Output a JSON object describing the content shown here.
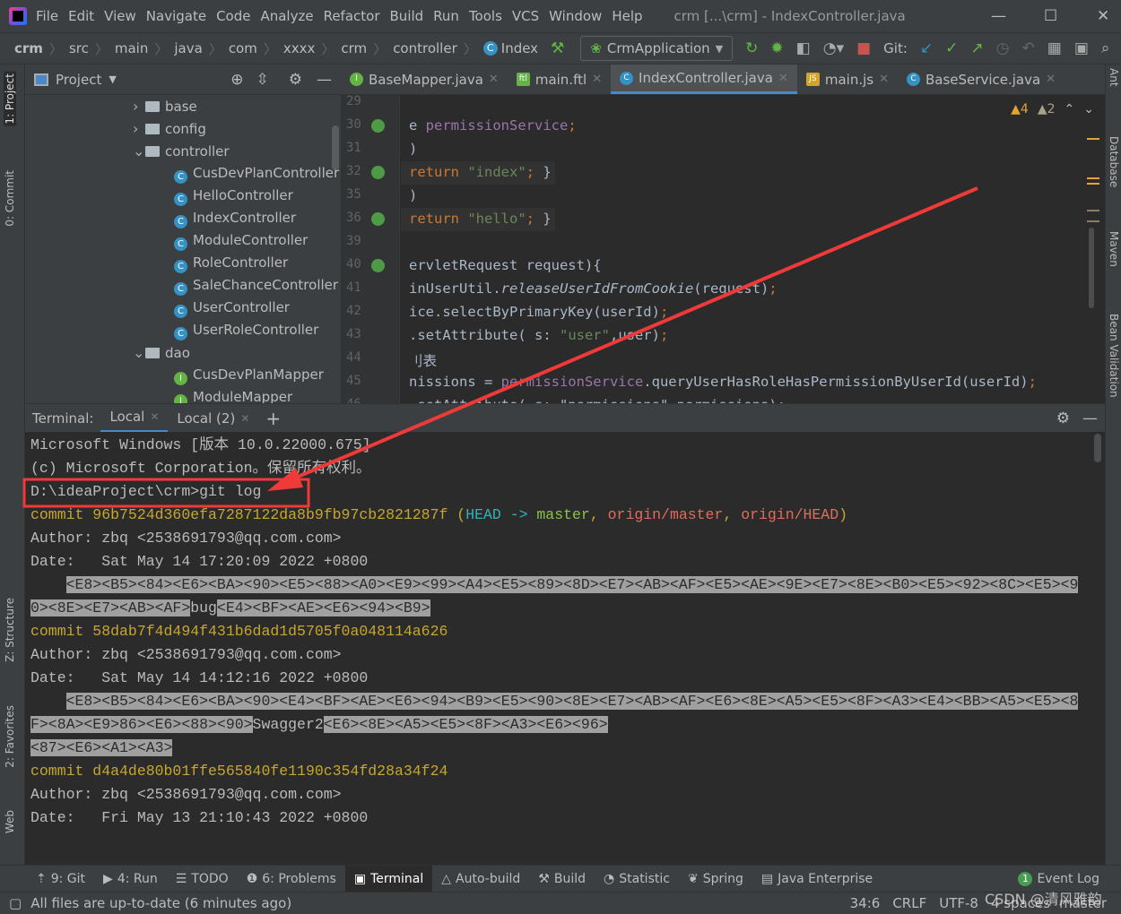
{
  "window": {
    "title": "crm [...\\crm] - IndexController.java",
    "menu": [
      "File",
      "Edit",
      "View",
      "Navigate",
      "Code",
      "Analyze",
      "Refactor",
      "Build",
      "Run",
      "Tools",
      "VCS",
      "Window",
      "Help"
    ],
    "controls": {
      "minimize": "—",
      "maximize": "☐",
      "close": "✕"
    }
  },
  "navbar": {
    "breadcrumbs": [
      "crm",
      "src",
      "main",
      "java",
      "com",
      "xxxx",
      "crm",
      "controller",
      "Index"
    ],
    "run_config": "CrmApplication",
    "git_label": "Git:"
  },
  "left_strip": [
    "1: Project",
    "0: Commit",
    "Z: Structure",
    "2: Favorites",
    "Web"
  ],
  "right_strip": [
    "Ant",
    "Database",
    "Maven",
    "Bean Validation"
  ],
  "project": {
    "title": "Project",
    "tree": [
      {
        "label": "base",
        "type": "folder",
        "depth": 0,
        "chevron": ">"
      },
      {
        "label": "config",
        "type": "folder",
        "depth": 0,
        "chevron": ">"
      },
      {
        "label": "controller",
        "type": "folder",
        "depth": 0,
        "chevron": "v"
      },
      {
        "label": "CusDevPlanController",
        "type": "class",
        "depth": 1
      },
      {
        "label": "HelloController",
        "type": "class",
        "depth": 1
      },
      {
        "label": "IndexController",
        "type": "class",
        "depth": 1
      },
      {
        "label": "ModuleController",
        "type": "class",
        "depth": 1
      },
      {
        "label": "RoleController",
        "type": "class",
        "depth": 1
      },
      {
        "label": "SaleChanceController",
        "type": "class",
        "depth": 1
      },
      {
        "label": "UserController",
        "type": "class",
        "depth": 1
      },
      {
        "label": "UserRoleController",
        "type": "class",
        "depth": 1
      },
      {
        "label": "dao",
        "type": "folder",
        "depth": 0,
        "chevron": "v"
      },
      {
        "label": "CusDevPlanMapper",
        "type": "interface",
        "depth": 1
      },
      {
        "label": "ModuleMapper",
        "type": "interface",
        "depth": 1
      }
    ]
  },
  "editor": {
    "tabs": [
      {
        "label": "BaseMapper.java",
        "icon": "I",
        "active": false
      },
      {
        "label": "main.ftl",
        "icon": "ftl",
        "active": false
      },
      {
        "label": "IndexController.java",
        "icon": "C",
        "active": true
      },
      {
        "label": "main.js",
        "icon": "JS",
        "active": false
      },
      {
        "label": "BaseService.java",
        "icon": "C",
        "active": false
      }
    ],
    "warnings": {
      "errors": "4",
      "weak": "2"
    },
    "lines": [
      {
        "n": "29",
        "parts": []
      },
      {
        "n": "30",
        "parts": [
          {
            "t": "e ",
            "c": ""
          },
          {
            "t": "permissionService",
            "c": "fld"
          },
          {
            "t": ";",
            "c": "kw"
          }
        ]
      },
      {
        "n": "31",
        "parts": [
          {
            "t": ")",
            "c": ""
          }
        ]
      },
      {
        "n": "32",
        "parts": [
          {
            "t": "return ",
            "c": "kw"
          },
          {
            "t": "\"index\"",
            "c": "str"
          },
          {
            "t": "; ",
            "c": "kw"
          },
          {
            "t": "}",
            "c": ""
          }
        ]
      },
      {
        "n": "35",
        "parts": [
          {
            "t": ")",
            "c": ""
          }
        ]
      },
      {
        "n": "36",
        "parts": [
          {
            "t": "return ",
            "c": "kw"
          },
          {
            "t": "\"hello\"",
            "c": "str"
          },
          {
            "t": "; ",
            "c": "kw"
          },
          {
            "t": "}",
            "c": ""
          }
        ]
      },
      {
        "n": "39",
        "parts": []
      },
      {
        "n": "40",
        "parts": [
          {
            "t": "ervletRequest request){",
            "c": ""
          }
        ]
      },
      {
        "n": "41",
        "parts": [
          {
            "t": "inUserUtil.",
            "c": ""
          },
          {
            "t": "releaseUserIdFromCookie",
            "c": "it"
          },
          {
            "t": "(request)",
            "c": ""
          },
          {
            "t": ";",
            "c": "kw"
          }
        ]
      },
      {
        "n": "42",
        "parts": [
          {
            "t": "ice.selectByPrimaryKey(userId)",
            "c": ""
          },
          {
            "t": ";",
            "c": "kw"
          }
        ]
      },
      {
        "n": "43",
        "parts": [
          {
            "t": ".setAttribute( ",
            "c": ""
          },
          {
            "t": "s: ",
            "c": ""
          },
          {
            "t": "\"user\"",
            "c": "str"
          },
          {
            "t": ",user)",
            "c": ""
          },
          {
            "t": ";",
            "c": "kw"
          }
        ]
      },
      {
        "n": "44",
        "parts": [
          {
            "t": "刂表",
            "c": ""
          }
        ]
      },
      {
        "n": "45",
        "parts": [
          {
            "t": "nissions = ",
            "c": ""
          },
          {
            "t": "permissionService",
            "c": "fld"
          },
          {
            "t": ".queryUserHasRoleHasPermissionByUserId(userId)",
            "c": ""
          },
          {
            "t": ";",
            "c": "kw"
          }
        ]
      },
      {
        "n": "46",
        "parts": [
          {
            "t": ".setAttribute( s: \"permissions\",permissions);",
            "c": ""
          }
        ]
      }
    ]
  },
  "terminal": {
    "label": "Terminal:",
    "tabs": [
      "Local",
      "Local (2)"
    ],
    "add": "+",
    "lines": [
      [
        {
          "t": "Microsoft Windows [版本 10.0.22000.675]",
          "c": ""
        }
      ],
      [
        {
          "t": "(c) Microsoft Corporation。保留所有权利。",
          "c": ""
        }
      ],
      [
        {
          "t": "D:\\ideaProject\\crm>git log",
          "c": ""
        }
      ],
      [
        {
          "t": "commit 96b7524d360efa7287122da8b9fb97cb2821287f ",
          "c": "yel"
        },
        {
          "t": "(",
          "c": "yel"
        },
        {
          "t": "HEAD -> ",
          "c": "cyan"
        },
        {
          "t": "master",
          "c": "grn"
        },
        {
          "t": ", ",
          "c": "yel"
        },
        {
          "t": "origin/master",
          "c": "red"
        },
        {
          "t": ", ",
          "c": "yel"
        },
        {
          "t": "origin/HEAD",
          "c": "red"
        },
        {
          "t": ")",
          "c": "yel"
        }
      ],
      [
        {
          "t": "Author: zbq <2538691793@qq.com.com>",
          "c": ""
        }
      ],
      [
        {
          "t": "Date:   Sat May 14 17:20:09 2022 +0800",
          "c": ""
        }
      ],
      [
        {
          "t": "    ",
          "c": ""
        },
        {
          "t": "<E8><B5><84><E6><BA><90><E5><88><A0><E9><99><A4><E5><89><8D><E7><AB><AF><E5><AE><9E><E7><8E><B0><E5><92><8C><E5><9",
          "c": "sel"
        }
      ],
      [
        {
          "t": "0><8E><E7><AB><AF>",
          "c": "sel"
        },
        {
          "t": "bug",
          "c": ""
        },
        {
          "t": "<E4><BF><AE><E6><94><B9>",
          "c": "sel"
        }
      ],
      [
        {
          "t": "commit 58dab7f4d494f431b6dad1d5705f0a048114a626",
          "c": "yel"
        }
      ],
      [
        {
          "t": "Author: zbq <2538691793@qq.com.com>",
          "c": ""
        }
      ],
      [
        {
          "t": "Date:   Sat May 14 14:12:16 2022 +0800",
          "c": ""
        }
      ],
      [
        {
          "t": "    ",
          "c": ""
        },
        {
          "t": "<E8><B5><84><E6><BA><90><E4><BF><AE><E6><94><B9><E5><90><8E><E7><AB><AF><E6><8E><A5><E5><8F><A3><E4><BB><A5><E5><8",
          "c": "sel"
        }
      ],
      [
        {
          "t": "F><8A><E9>86><E6><88><90>",
          "c": "sel"
        },
        {
          "t": "Swagger2",
          "c": ""
        },
        {
          "t": "<E6><8E><A5><E5><8F><A3><E6><96>",
          "c": "sel"
        }
      ],
      [
        {
          "t": "<87><E6><A1><A3>",
          "c": "sel"
        }
      ],
      [
        {
          "t": "commit d4a4de80b01ffe565840fe1190c354fd28a34f24",
          "c": "yel"
        }
      ],
      [
        {
          "t": "Author: zbq <2538691793@qq.com.com>",
          "c": ""
        }
      ],
      [
        {
          "t": "Date:   Fri May 13 21:10:43 2022 +0800",
          "c": ""
        }
      ]
    ]
  },
  "tool_windows": [
    {
      "label": "9: Git",
      "icon": "git-icon"
    },
    {
      "label": "4: Run",
      "icon": "run-icon"
    },
    {
      "label": "TODO",
      "icon": "list-icon"
    },
    {
      "label": "6: Problems",
      "icon": "problems-icon"
    },
    {
      "label": "Terminal",
      "icon": "terminal-icon",
      "active": true
    },
    {
      "label": "Auto-build",
      "icon": "warning-triangle-icon"
    },
    {
      "label": "Build",
      "icon": "hammer-icon"
    },
    {
      "label": "Statistic",
      "icon": "statistic-icon"
    },
    {
      "label": "Spring",
      "icon": "spring-icon"
    },
    {
      "label": "Java Enterprise",
      "icon": "java-enterprise-icon"
    }
  ],
  "event_log": {
    "label": "Event Log",
    "count": "1"
  },
  "status": {
    "message": "All files are up-to-date (6 minutes ago)",
    "position": "34:6",
    "line_sep": "CRLF",
    "encoding": "UTF-8",
    "indent": "4 spaces",
    "branch": "master",
    "watermark": "CSDN @清风雅韵"
  },
  "colors": {
    "annotation": "#f03a3a",
    "accent": "#4a88c7"
  }
}
